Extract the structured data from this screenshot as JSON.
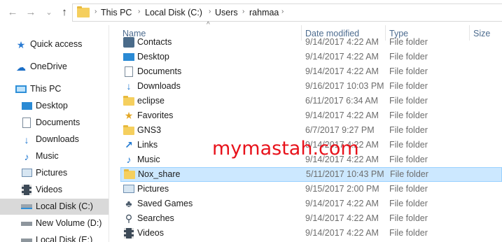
{
  "nav": {
    "back_glyph": "←",
    "forward_glyph": "→",
    "recent_glyph": "⌄",
    "up_glyph": "↑"
  },
  "breadcrumb": [
    "This PC",
    "Local Disk (C:)",
    "Users",
    "rahmaa"
  ],
  "breadcrumb_separator": "›",
  "sidebar": {
    "items": [
      {
        "label": "Quick access",
        "icon": "star-icon"
      },
      {
        "label": "OneDrive",
        "icon": "cloud-icon"
      },
      {
        "label": "This PC",
        "icon": "monitor-icon"
      },
      {
        "label": "Desktop",
        "icon": "desktop-icon"
      },
      {
        "label": "Documents",
        "icon": "documents-icon"
      },
      {
        "label": "Downloads",
        "icon": "download-icon"
      },
      {
        "label": "Music",
        "icon": "music-note-icon"
      },
      {
        "label": "Pictures",
        "icon": "pictures-icon"
      },
      {
        "label": "Videos",
        "icon": "film-icon"
      },
      {
        "label": "Local Disk (C:)",
        "icon": "drive-icon"
      },
      {
        "label": "New Volume (D:)",
        "icon": "drive-icon"
      },
      {
        "label": "Local Disk (E:)",
        "icon": "drive-icon"
      }
    ]
  },
  "columns": {
    "name": "Name",
    "date": "Date modified",
    "type": "Type",
    "size": "Size",
    "sort_glyph": "^"
  },
  "files": [
    {
      "name": "Contacts",
      "date": "9/14/2017 4:22 AM",
      "type": "File folder",
      "icon": "contacts-icon"
    },
    {
      "name": "Desktop",
      "date": "9/14/2017 4:22 AM",
      "type": "File folder",
      "icon": "desktop-icon"
    },
    {
      "name": "Documents",
      "date": "9/14/2017 4:22 AM",
      "type": "File folder",
      "icon": "documents-icon"
    },
    {
      "name": "Downloads",
      "date": "9/16/2017 10:03 PM",
      "type": "File folder",
      "icon": "download-icon"
    },
    {
      "name": "eclipse",
      "date": "6/11/2017 6:34 AM",
      "type": "File folder",
      "icon": "folder-icon"
    },
    {
      "name": "Favorites",
      "date": "9/14/2017 4:22 AM",
      "type": "File folder",
      "icon": "star-icon"
    },
    {
      "name": "GNS3",
      "date": "6/7/2017 9:27 PM",
      "type": "File folder",
      "icon": "folder-icon"
    },
    {
      "name": "Links",
      "date": "9/14/2017 4:22 AM",
      "type": "File folder",
      "icon": "link-arrow-icon"
    },
    {
      "name": "Music",
      "date": "9/14/2017 4:22 AM",
      "type": "File folder",
      "icon": "music-note-icon"
    },
    {
      "name": "Nox_share",
      "date": "5/11/2017 10:43 PM",
      "type": "File folder",
      "icon": "folder-icon"
    },
    {
      "name": "Pictures",
      "date": "9/15/2017 2:00 PM",
      "type": "File folder",
      "icon": "pictures-icon"
    },
    {
      "name": "Saved Games",
      "date": "9/14/2017 4:22 AM",
      "type": "File folder",
      "icon": "saved-games-icon"
    },
    {
      "name": "Searches",
      "date": "9/14/2017 4:22 AM",
      "type": "File folder",
      "icon": "search-icon"
    },
    {
      "name": "Videos",
      "date": "9/14/2017 4:22 AM",
      "type": "File folder",
      "icon": "film-icon"
    }
  ],
  "selected_file": "Nox_share",
  "selected_sidebar": "Local Disk (C:)",
  "watermark": "mymastah.com",
  "colors": {
    "selection_bg": "#cce8ff",
    "selection_border": "#99d1ff",
    "sidebar_selected": "#d9d9d9",
    "header_text": "#4d6c8f",
    "watermark": "#e8121b",
    "folder": "#f5cf5e"
  }
}
